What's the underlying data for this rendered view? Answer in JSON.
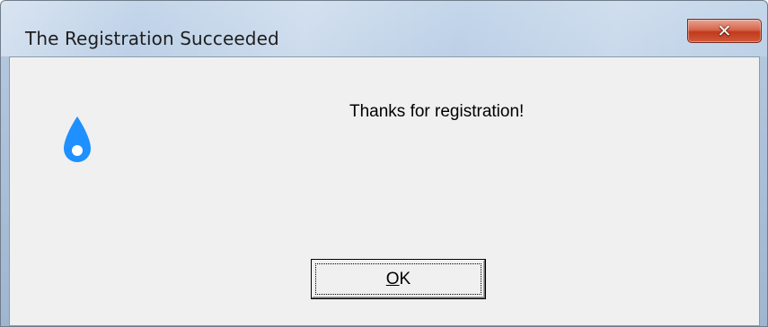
{
  "window": {
    "title": "The Registration Succeeded",
    "close_icon": "close-x-icon"
  },
  "dialog": {
    "icon": "water-drop-icon",
    "icon_color": "#1e90ff",
    "message": "Thanks for registration!",
    "ok_button": {
      "mnemonic": "O",
      "rest": "K"
    }
  }
}
